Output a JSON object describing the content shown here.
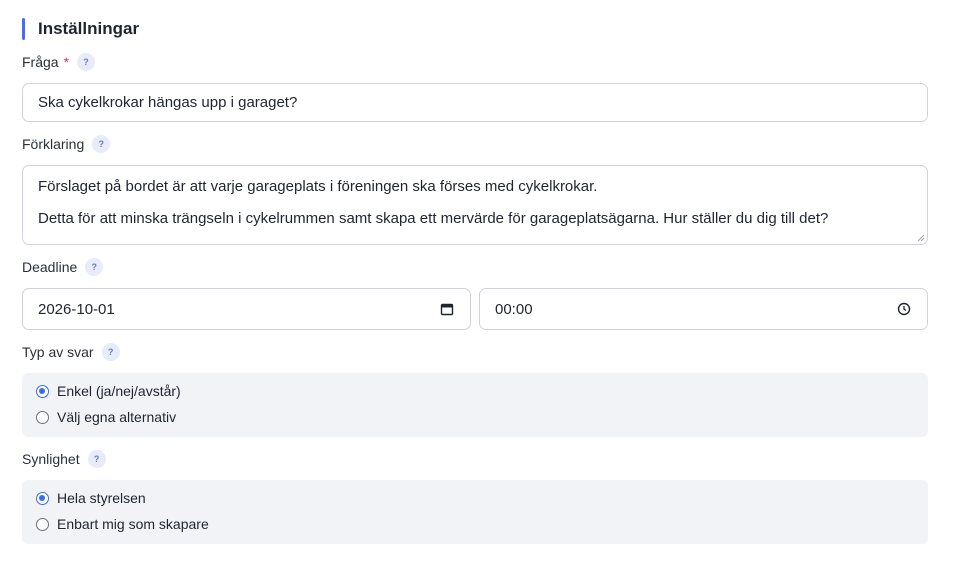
{
  "section": {
    "title": "Inställningar"
  },
  "help_glyph": "?",
  "question": {
    "label": "Fråga",
    "required_mark": "*",
    "value": "Ska cykelkrokar hängas upp i garaget?"
  },
  "explanation": {
    "label": "Förklaring",
    "line1": "Förslaget på bordet är att varje garageplats i föreningen ska förses med cykelkrokar.",
    "line2": "Detta för att minska trängseln i cykelrummen samt skapa ett mervärde för garageplatsägarna. Hur ställer du dig till det?"
  },
  "deadline": {
    "label": "Deadline",
    "date": "2026-10-01",
    "time": "00:00"
  },
  "answer_type": {
    "label": "Typ av svar",
    "options": [
      {
        "label": "Enkel (ja/nej/avstår)",
        "checked": true
      },
      {
        "label": "Välj egna alternativ",
        "checked": false
      }
    ]
  },
  "visibility": {
    "label": "Synlighet",
    "options": [
      {
        "label": "Hela styrelsen",
        "checked": true
      },
      {
        "label": "Enbart mig som skapare",
        "checked": false
      }
    ]
  },
  "colors": {
    "accent": "#4a6cf0",
    "required": "#e0344a",
    "radio_checked": "#3b6bf0",
    "option_bg": "#f1f3f7"
  }
}
